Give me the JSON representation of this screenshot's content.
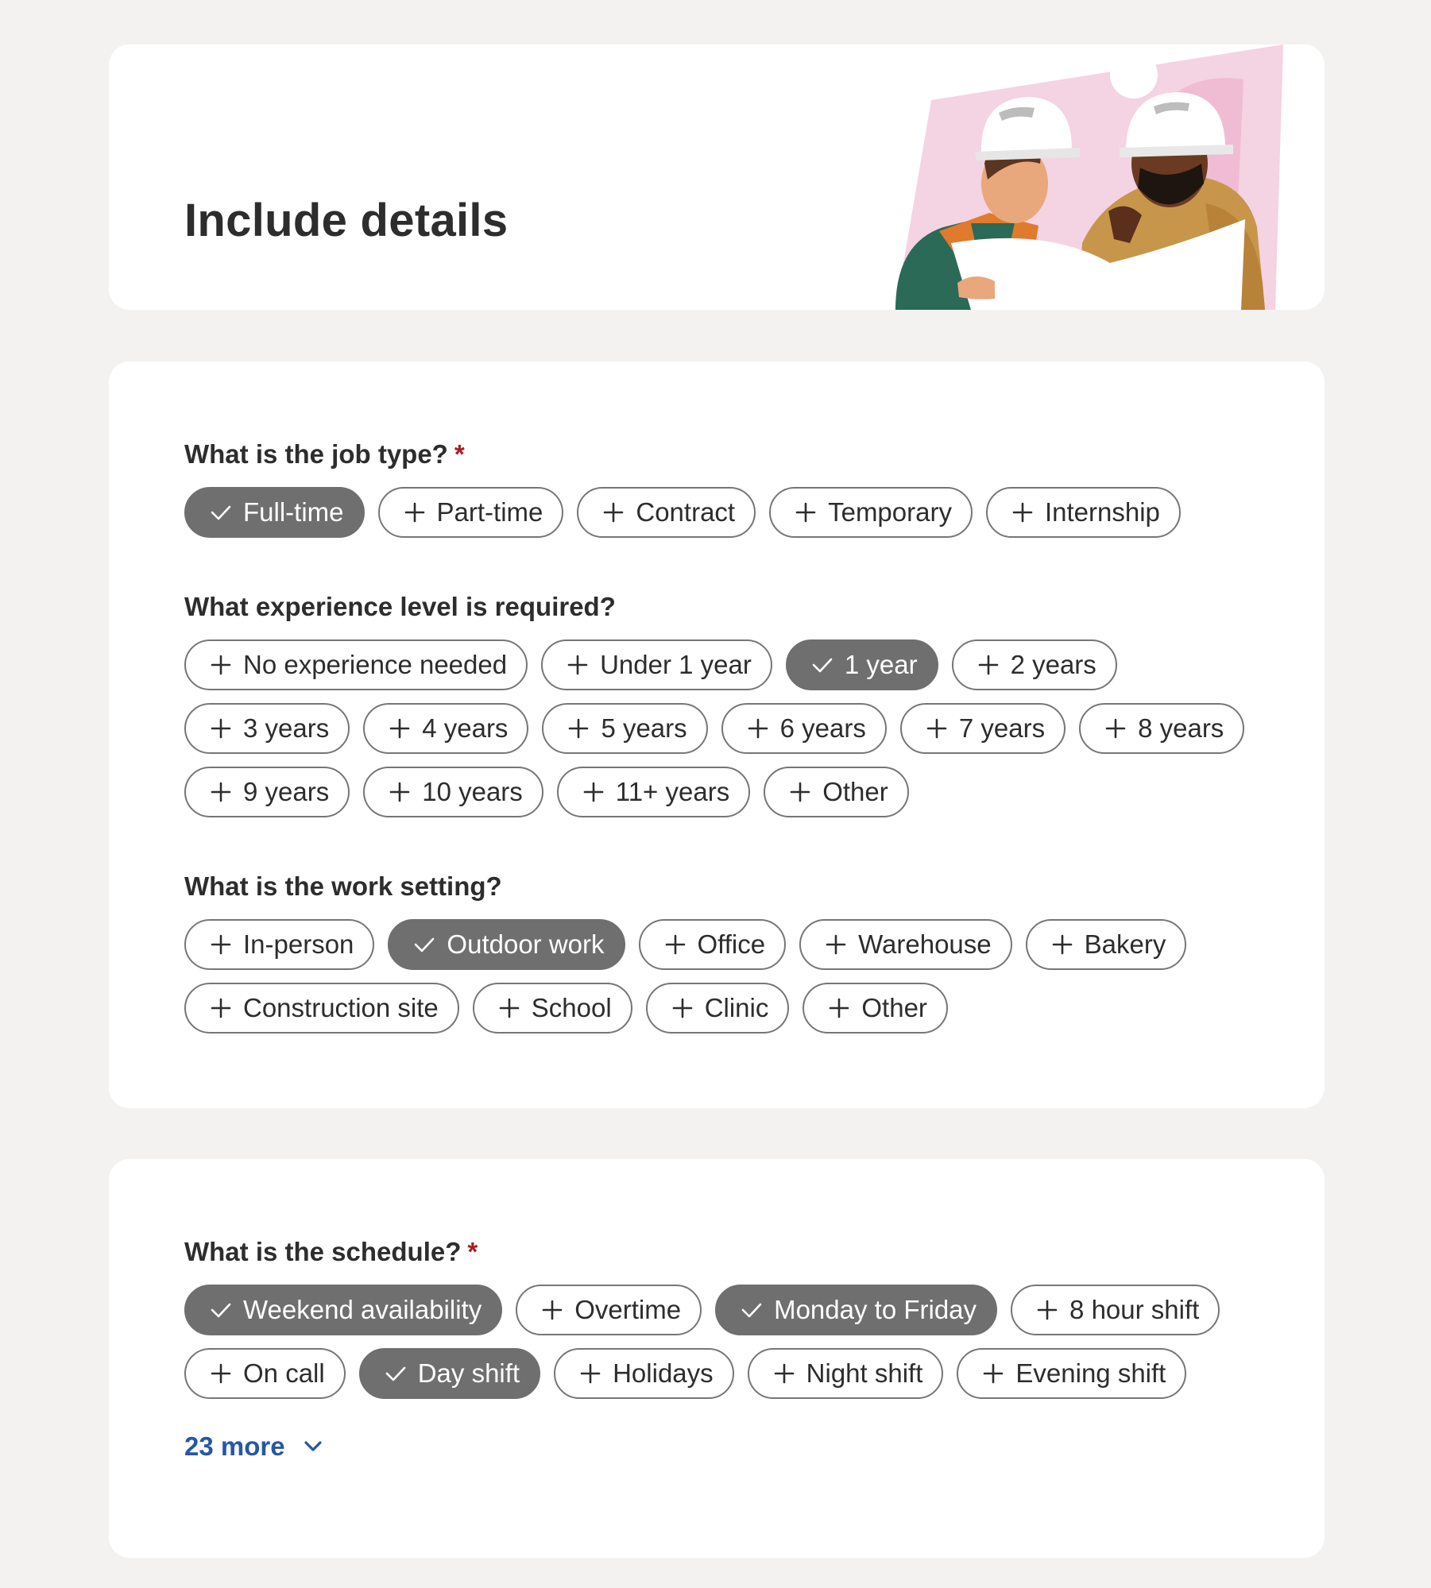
{
  "header": {
    "title": "Include details"
  },
  "colors": {
    "background": "#f3f2f1",
    "card": "#ffffff",
    "chip_selected": "#6f6f6f",
    "chip_border": "#767676",
    "required": "#b01825",
    "link": "#2557a7"
  },
  "job_type": {
    "question": "What is the job type?",
    "required_mark": "*",
    "options": [
      {
        "label": "Full-time",
        "selected": true
      },
      {
        "label": "Part-time",
        "selected": false
      },
      {
        "label": "Contract",
        "selected": false
      },
      {
        "label": "Temporary",
        "selected": false
      },
      {
        "label": "Internship",
        "selected": false
      }
    ]
  },
  "experience": {
    "question": "What experience level is required?",
    "rows": [
      [
        {
          "label": "No experience needed",
          "selected": false
        },
        {
          "label": "Under 1 year",
          "selected": false
        },
        {
          "label": "1 year",
          "selected": true
        },
        {
          "label": "2 years",
          "selected": false
        }
      ],
      [
        {
          "label": "3 years",
          "selected": false
        },
        {
          "label": "4 years",
          "selected": false
        },
        {
          "label": "5 years",
          "selected": false
        },
        {
          "label": "6 years",
          "selected": false
        },
        {
          "label": "7 years",
          "selected": false
        },
        {
          "label": "8 years",
          "selected": false
        }
      ],
      [
        {
          "label": "9 years",
          "selected": false
        },
        {
          "label": "10 years",
          "selected": false
        },
        {
          "label": "11+ years",
          "selected": false
        },
        {
          "label": "Other",
          "selected": false
        }
      ]
    ]
  },
  "work_setting": {
    "question": "What is the work setting?",
    "rows": [
      [
        {
          "label": "In-person",
          "selected": false
        },
        {
          "label": "Outdoor work",
          "selected": true
        },
        {
          "label": "Office",
          "selected": false
        },
        {
          "label": "Warehouse",
          "selected": false
        },
        {
          "label": "Bakery",
          "selected": false
        }
      ],
      [
        {
          "label": "Construction site",
          "selected": false
        },
        {
          "label": "School",
          "selected": false
        },
        {
          "label": "Clinic",
          "selected": false
        },
        {
          "label": "Other",
          "selected": false
        }
      ]
    ]
  },
  "schedule": {
    "question": "What is the schedule?",
    "required_mark": "*",
    "rows": [
      [
        {
          "label": "Weekend availability",
          "selected": true
        },
        {
          "label": "Overtime",
          "selected": false
        },
        {
          "label": "Monday to Friday",
          "selected": true
        },
        {
          "label": "8 hour shift",
          "selected": false
        }
      ],
      [
        {
          "label": "On call",
          "selected": false
        },
        {
          "label": "Day shift",
          "selected": true
        },
        {
          "label": "Holidays",
          "selected": false
        },
        {
          "label": "Night shift",
          "selected": false
        },
        {
          "label": "Evening shift",
          "selected": false
        }
      ]
    ],
    "more_label": "23 more",
    "more_icon": "chevron-down-icon"
  },
  "icons": {
    "unselected": "plus-icon",
    "selected": "check-icon",
    "illustration": "construction-workers-illustration"
  }
}
